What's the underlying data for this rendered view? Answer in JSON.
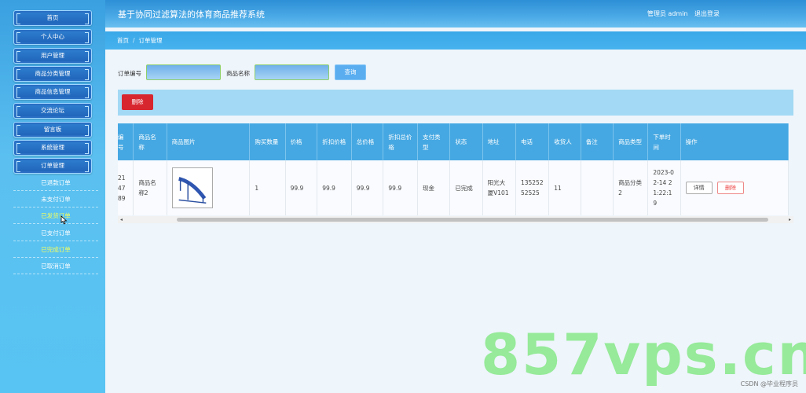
{
  "sidebar": {
    "menu": [
      "首页",
      "个人中心",
      "用户管理",
      "商品分类管理",
      "商品信息管理",
      "交流论坛",
      "留言板",
      "系统管理",
      "订单管理"
    ],
    "submenu": [
      "已退款订单",
      "未支付订单",
      "已发货订单",
      "已支付订单",
      "已完成订单",
      "已取消订单"
    ]
  },
  "header": {
    "title": "基于协同过滤算法的体育商品推荐系统",
    "user": "管理员 admin",
    "logout": "退出登录"
  },
  "breadcrumb": {
    "home": "首页",
    "sep": "/",
    "current": "订单管理"
  },
  "search": {
    "order_no_label": "订单编号",
    "product_name_label": "商品名称",
    "query_label": "查询"
  },
  "actions": {
    "delete_label": "删除"
  },
  "table": {
    "headers": [
      "编号",
      "商品名称",
      "商品图片",
      "购买数量",
      "价格",
      "折扣价格",
      "总价格",
      "折扣总价格",
      "支付类型",
      "状态",
      "地址",
      "电话",
      "收货人",
      "备注",
      "商品类型",
      "下单时间",
      "操作"
    ],
    "row": {
      "order_no": "214789",
      "product_name": "商品名称2",
      "image_alt": "fitness-bench",
      "quantity": "1",
      "price": "99.9",
      "discount_price": "99.9",
      "total": "99.9",
      "discount_total": "99.9",
      "pay_type": "现金",
      "status": "已完成",
      "address": "阳光大厦V101",
      "phone": "13525252525",
      "receiver": "11",
      "remark": "",
      "category": "商品分类2",
      "order_time": "2023-02-14 21:22:19",
      "detail_label": "详情",
      "delete_label": "删除"
    }
  },
  "watermark": {
    "big": "857vps.cn",
    "small": "CSDN @毕业程序员"
  },
  "colors": {
    "accent": "#46a8e2",
    "danger": "#d8262f",
    "sidebar": "#58c4f3"
  }
}
